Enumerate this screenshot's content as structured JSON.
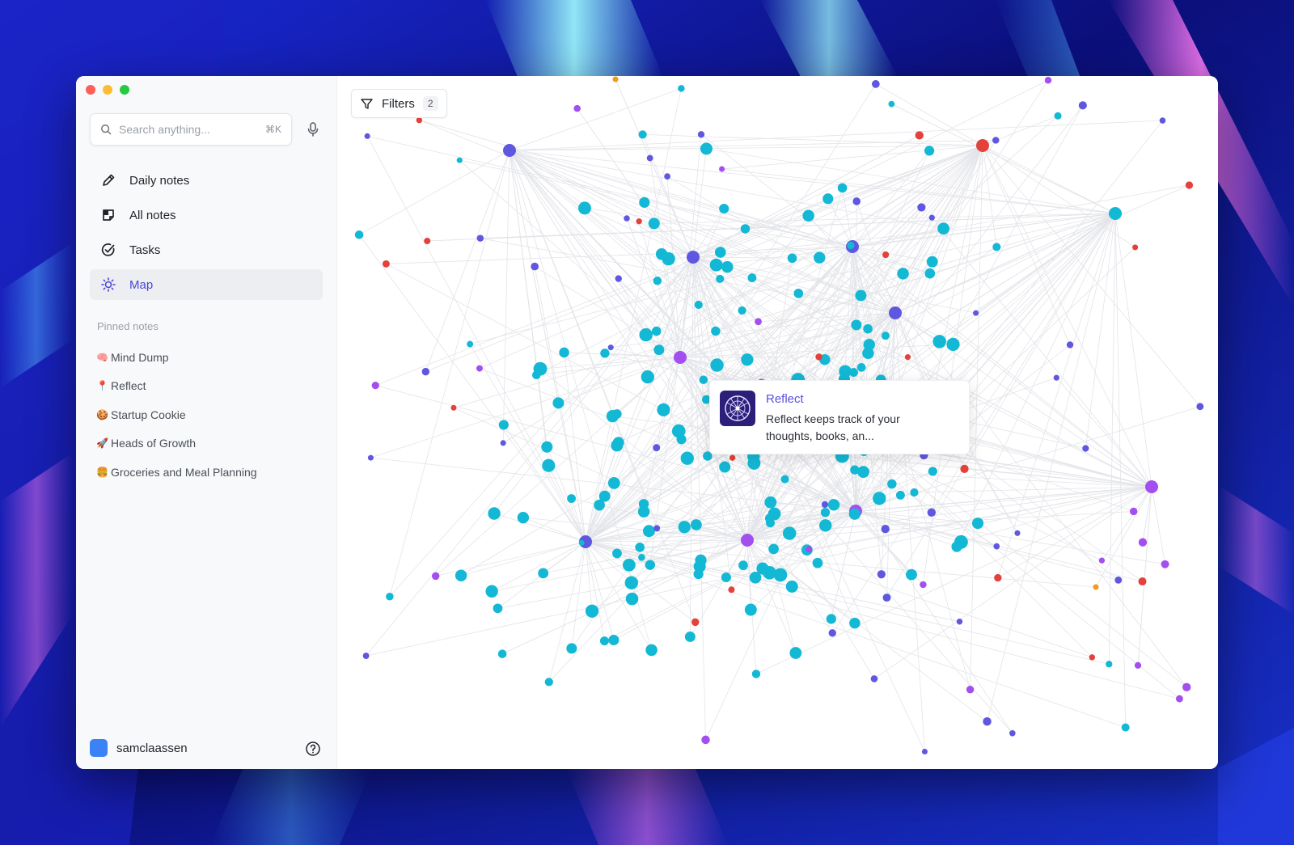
{
  "window": {
    "traffic_lights": [
      "#fe5f57",
      "#febc2e",
      "#28c840"
    ]
  },
  "search": {
    "placeholder": "Search anything...",
    "shortcut": "⌘K",
    "icon": "search-icon"
  },
  "nav": [
    {
      "label": "Daily notes",
      "icon": "pencil-icon",
      "active": false
    },
    {
      "label": "All notes",
      "icon": "notes-icon",
      "active": false
    },
    {
      "label": "Tasks",
      "icon": "check-circle-icon",
      "active": false
    },
    {
      "label": "Map",
      "icon": "sun-icon",
      "active": true
    }
  ],
  "pinned": {
    "label": "Pinned notes",
    "items": [
      {
        "emoji": "🧠",
        "label": "Mind Dump"
      },
      {
        "emoji": "📍",
        "label": "Reflect"
      },
      {
        "emoji": "🍪",
        "label": "Startup Cookie"
      },
      {
        "emoji": "🚀",
        "label": "Heads of Growth"
      },
      {
        "emoji": "🍔",
        "label": "Groceries and Meal Planning"
      }
    ]
  },
  "user": {
    "name": "samclaassen",
    "avatar_color": "#3b82f6"
  },
  "filters": {
    "label": "Filters",
    "count": "2"
  },
  "tooltip": {
    "title": "Reflect",
    "description": "Reflect keeps track of your thoughts, books, an..."
  },
  "colors": {
    "accent": "#4b47d6",
    "node_cyan": "#13b8d4",
    "node_indigo": "#6057e0",
    "node_purple": "#a34ff0",
    "node_red": "#e5413b",
    "node_orange": "#f29a1a",
    "edge": "#e3e4e9"
  }
}
